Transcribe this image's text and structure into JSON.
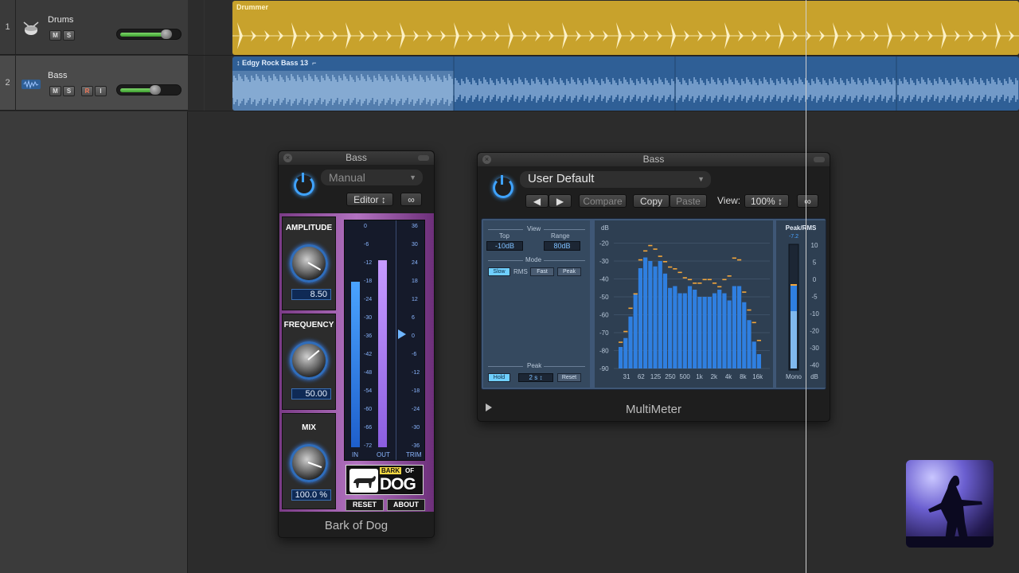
{
  "tracks": [
    {
      "number": "1",
      "name": "Drums",
      "buttons": [
        "M",
        "S"
      ],
      "volume": 0.82
    },
    {
      "number": "2",
      "name": "Bass",
      "buttons": [
        "M",
        "S",
        "R",
        "I"
      ],
      "volume": 0.62
    }
  ],
  "regions": {
    "drummer_title": "Drummer",
    "bass_title": "Edgy Rock Bass 13",
    "loop_icon": "loop-icon"
  },
  "bark_of_dog": {
    "window_title": "Bass",
    "preset": "Manual",
    "editor_label": "Editor",
    "link_icon": "link-icon",
    "amplitude_label": "AMPLITUDE",
    "amplitude_value": "8.50",
    "frequency_label": "FREQUENCY",
    "frequency_value": "50.00",
    "mix_label": "MIX",
    "mix_value": "100.0 %",
    "meter_in_label": "IN",
    "meter_out_label": "OUT",
    "meter_trim_label": "TRIM",
    "logo_top": "BARK",
    "logo_of": "OF",
    "logo_bottom": "DOG",
    "reset_label": "RESET",
    "about_label": "ABOUT",
    "footer_title": "Bark of Dog",
    "in_level": 0.78,
    "out_level": 0.88,
    "left_scale": [
      "0",
      "-6",
      "-12",
      "-18",
      "-24",
      "-30",
      "-36",
      "-42",
      "-48",
      "-54",
      "-60",
      "-66",
      "-72"
    ],
    "right_scale": [
      "36",
      "30",
      "24",
      "18",
      "12",
      "6",
      "0",
      "-6",
      "-12",
      "-18",
      "-24",
      "-30",
      "-36"
    ]
  },
  "multimeter": {
    "window_title": "Bass",
    "preset": "User Default",
    "compare_label": "Compare",
    "copy_label": "Copy",
    "paste_label": "Paste",
    "view_label": "View:",
    "view_value": "100%",
    "view_heading": "View",
    "top_label": "Top",
    "top_value": "-10dB",
    "range_label": "Range",
    "range_value": "80dB",
    "mode_heading": "Mode",
    "slow_label": "Slow",
    "rms_label": "RMS",
    "fast_label": "Fast",
    "peak_btn_label": "Peak",
    "peak_heading": "Peak",
    "hold_label": "Hold",
    "hold_time": "2 s",
    "reset_label": "Reset",
    "db_axis_title": "dB",
    "db_labels": [
      "-20",
      "-30",
      "-40",
      "-50",
      "-60",
      "-70",
      "-80",
      "-90"
    ],
    "freq_labels": [
      "31",
      "62",
      "125",
      "250",
      "500",
      "1k",
      "2k",
      "4k",
      "8k",
      "16k"
    ],
    "peakrms_title": "Peak/RMS",
    "peakrms_value": "-7.2",
    "peakrms_scale": [
      "10",
      "5",
      "0",
      "-5",
      "-10",
      "-20",
      "-30",
      "-40"
    ],
    "mono_label": "Mono",
    "db_unit": "dB",
    "footer_title": "MultiMeter",
    "expand_icon": "triangle-right-icon",
    "bars_db": [
      -78,
      -73,
      -61,
      -48,
      -34,
      -28,
      -30,
      -33,
      -30,
      -37,
      -45,
      -44,
      -48,
      -48,
      -44,
      -46,
      -50,
      -50,
      -50,
      -48,
      -46,
      -48,
      -52,
      -44,
      -44,
      -53,
      -63,
      -75,
      -82
    ],
    "peaks_db": [
      -75,
      -69,
      -56,
      -48,
      -29,
      -24,
      -21,
      -23,
      -27,
      -30,
      -33,
      -34,
      -36,
      -39,
      -40,
      -42,
      -42,
      -40,
      -40,
      -42,
      -44,
      -40,
      -38,
      -28,
      -29,
      -47,
      -57,
      -64,
      -74
    ]
  },
  "colors": {
    "drummer_region": "#c8a22c",
    "bass_region": "#2f5f96",
    "accent_blue": "#3fa3ff",
    "bar_blue": "#2f7fe0",
    "peak_orange": "#f2a53a"
  },
  "thumbnail_icon": "guitarist-photo"
}
